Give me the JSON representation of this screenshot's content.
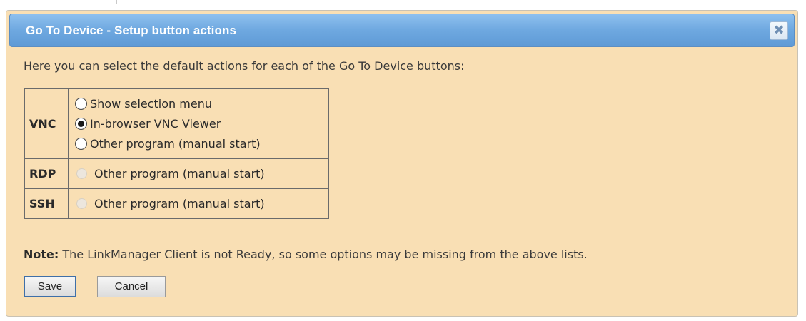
{
  "dialog": {
    "title": "Go To Device - Setup button actions",
    "close_glyph": "✖",
    "intro": "Here you can select the default actions for each of the Go To Device buttons:"
  },
  "table": {
    "rows": [
      {
        "protocol": "VNC",
        "options": [
          {
            "label": "Show selection menu",
            "selected": false,
            "enabled": true
          },
          {
            "label": "In-browser VNC Viewer",
            "selected": true,
            "enabled": true
          },
          {
            "label": "Other program (manual start)",
            "selected": false,
            "enabled": true
          }
        ]
      },
      {
        "protocol": "RDP",
        "options": [
          {
            "label": "Other program (manual start)",
            "selected": false,
            "enabled": false
          }
        ]
      },
      {
        "protocol": "SSH",
        "options": [
          {
            "label": "Other program (manual start)",
            "selected": false,
            "enabled": false
          }
        ]
      }
    ]
  },
  "note": {
    "label": "Note:",
    "text": " The LinkManager Client is not Ready, so some options may be missing from the above lists."
  },
  "buttons": {
    "save_label": "Save",
    "cancel_label": "Cancel"
  },
  "colors": {
    "dialog_bg": "#f9dfb4",
    "titlebar": "#6ea8e0",
    "title_text": "#ffffff"
  },
  "icons": {
    "close": "close-icon"
  }
}
